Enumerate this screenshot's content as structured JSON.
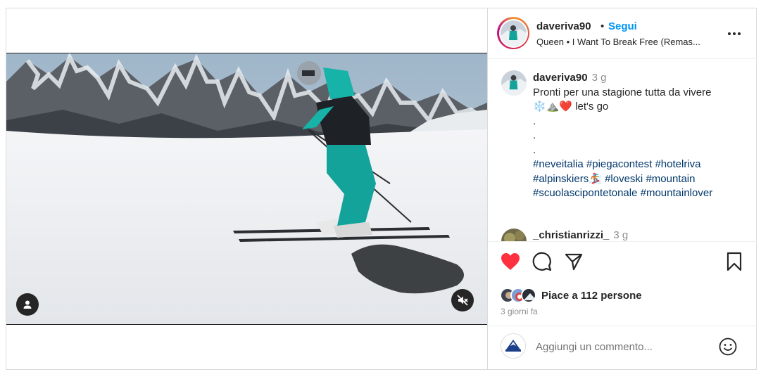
{
  "post": {
    "username": "daveriva90",
    "separator": "•",
    "follow_label": "Segui",
    "song": "Queen • I Want To Break Free (Remas...",
    "more_icon": "more-horizontal-icon"
  },
  "caption": {
    "username": "daveriva90",
    "time": "3 g",
    "line1": "Pronti per una stagione tutta da vivere",
    "emojis": "❄️⛰️❤️",
    "line2_suffix": " let's go",
    "dot1": ".",
    "dot2": ".",
    "dot3": ".",
    "hashtags": [
      "#neveitalia",
      "#piegacontest",
      "#hotelriva",
      "#alpinskiers🏂",
      "#loveski",
      "#mountain",
      "#scuolascipontetonale",
      "#mountainlover"
    ]
  },
  "comment2": {
    "username": "_christianrizzi_",
    "time": "3 g"
  },
  "actions": {
    "like_icon": "heart-filled-icon",
    "comment_icon": "comment-icon",
    "share_icon": "share-icon",
    "save_icon": "bookmark-icon",
    "like_color": "#ff3040",
    "likes_text": "Piace a 112 persone",
    "date": "3 giorni fa"
  },
  "add_comment": {
    "placeholder": "Aggiungi un commento...",
    "emoji_icon": "emoji-icon",
    "avatar_brand": "NEVEITALIA"
  },
  "colors": {
    "follow": "#0095f6",
    "hashtag": "#00376b",
    "muted_text": "#8e8e8e"
  }
}
